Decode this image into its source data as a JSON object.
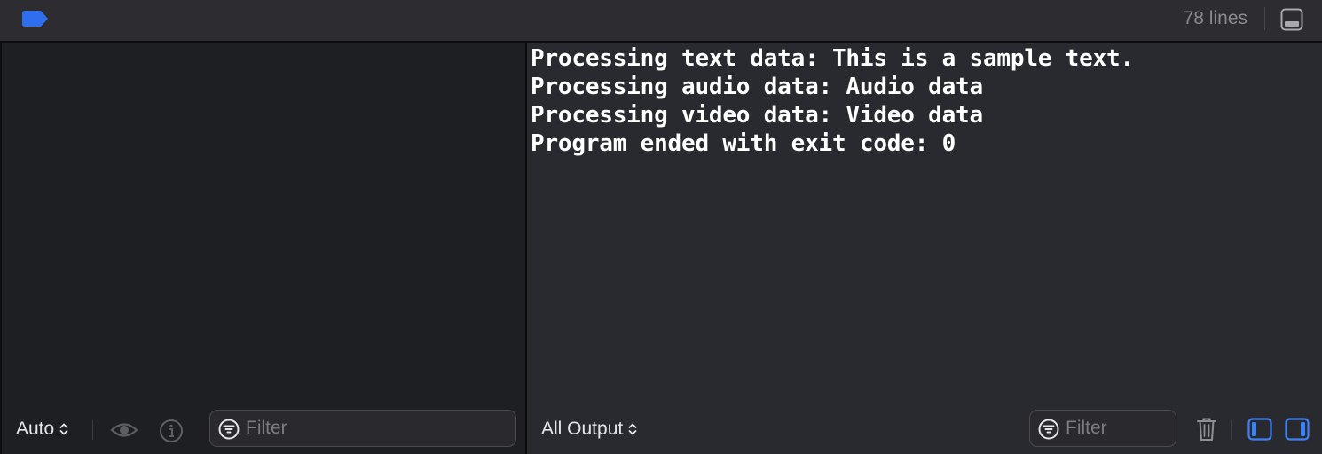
{
  "topbar": {
    "line_count": "78 lines",
    "tag_color": "#2f6fef"
  },
  "console": {
    "lines": [
      "Processing text data: This is a sample text.",
      "Processing audio data: Audio data",
      "Processing video data: Video data",
      "Program ended with exit code: 0"
    ]
  },
  "variables_bar": {
    "scope_selected": "Auto",
    "filter_placeholder": "Filter",
    "icons": [
      "eye-icon",
      "info-icon",
      "filter-icon"
    ]
  },
  "console_bar": {
    "output_selected": "All Output",
    "filter_placeholder": "Filter",
    "icons": [
      "filter-icon",
      "trash-icon",
      "show-left-pane-icon",
      "show-right-pane-icon"
    ]
  },
  "colors": {
    "accent": "#3b82f6",
    "console_text": "#ffffff",
    "console_bg": "#292a2f",
    "variables_bg": "#1e1f22"
  }
}
